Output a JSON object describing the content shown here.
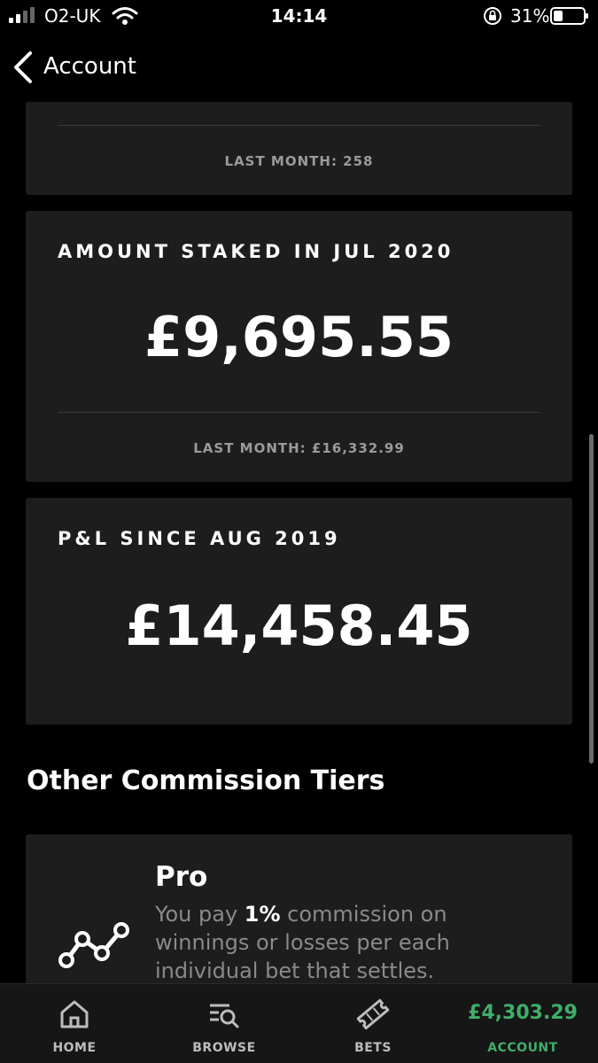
{
  "status_bar": {
    "carrier": "O2-UK",
    "time": "14:14",
    "battery": "31%"
  },
  "nav": {
    "back_label": "Account"
  },
  "bets_card": {
    "last_month": "LAST MONTH: 258"
  },
  "staked_card": {
    "label": "AMOUNT STAKED IN JUL 2020",
    "value": "£9,695.55",
    "last_month": "LAST MONTH: £16,332.99"
  },
  "pnl_card": {
    "label": "P&L SINCE AUG 2019",
    "value": "£14,458.45"
  },
  "other_tiers": {
    "title": "Other Commission Tiers",
    "tiers": [
      {
        "name": "Pro",
        "desc_prefix": "You pay ",
        "desc_bold": "1%",
        "desc_suffix": " commission on winnings or losses per each individual bet that settles."
      }
    ]
  },
  "tab_bar": {
    "tabs": [
      {
        "label": "HOME",
        "icon": "home-icon"
      },
      {
        "label": "BROWSE",
        "icon": "browse-icon"
      },
      {
        "label": "BETS",
        "icon": "ticket-icon"
      },
      {
        "label": "ACCOUNT",
        "balance": "£4,303.29",
        "active": true
      }
    ]
  },
  "colors": {
    "accent": "#3fae6a",
    "card": "#1d1d1d",
    "background": "#000000"
  }
}
